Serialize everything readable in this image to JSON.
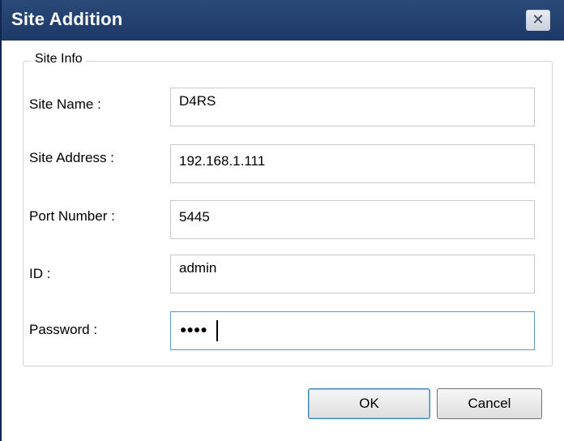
{
  "window": {
    "title": "Site Addition",
    "close_glyph": "✕"
  },
  "group": {
    "legend": "Site Info"
  },
  "fields": [
    {
      "label": "Site Name :",
      "value": "D4RS"
    },
    {
      "label": "Site Address :",
      "value": "192.168.1.111"
    },
    {
      "label": "Port Number :",
      "value": "5445"
    },
    {
      "label": "ID :",
      "value": "admin"
    },
    {
      "label": "Password :",
      "value": "●●●●",
      "masked": true,
      "focused": true
    }
  ],
  "buttons": {
    "ok": "OK",
    "cancel": "Cancel"
  },
  "colors": {
    "titlebar": "#1c3866",
    "focus_border": "#5f95c8"
  }
}
